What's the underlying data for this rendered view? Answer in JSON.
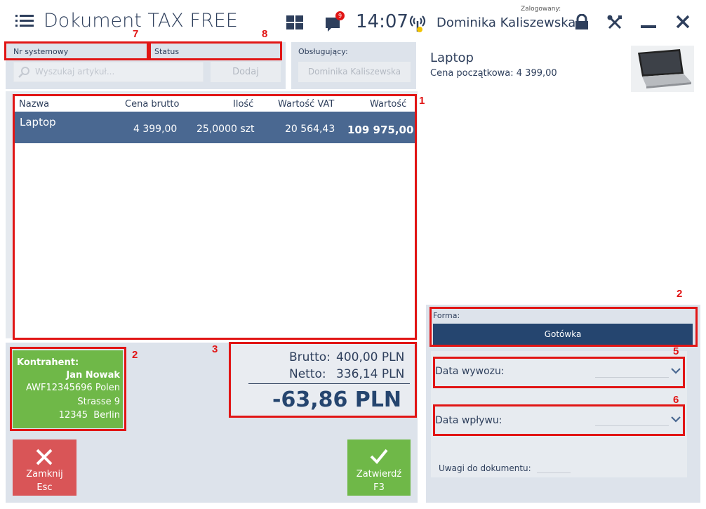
{
  "header": {
    "title": "Dokument TAX FREE",
    "notification_count": "9",
    "time": "14:07",
    "login_label": "Zalogowany:",
    "user_name": "Dominika Kaliszewska"
  },
  "filters": {
    "system_number_label": "Nr systemowy",
    "status_label": "Status",
    "search_placeholder": "Wyszukaj artykuł...",
    "add_button": "Dodaj",
    "operator_label": "Obsługujący:",
    "operator_value": "Dominika Kaliszewska"
  },
  "table": {
    "headers": [
      "Nazwa",
      "Cena brutto",
      "Ilość",
      "Wartość VAT",
      "Wartość"
    ],
    "rows": [
      {
        "name": "Laptop",
        "price": "4 399,00",
        "qty": "25,0000 szt",
        "vat": "20 564,43",
        "value": "109 975,00"
      }
    ]
  },
  "customer": {
    "label": "Kontrahent:",
    "name": "Jan Nowak",
    "line1": "AWF12345696 Polen",
    "line2": "Strasse 9",
    "line3": "12345  Berlin"
  },
  "totals": {
    "brutto_label": "Brutto:",
    "brutto_value": "400,00 PLN",
    "netto_label": "Netto:",
    "netto_value": "336,14 PLN",
    "total": "-63,86 PLN"
  },
  "actions": {
    "close_label": "Zamknij",
    "close_key": "Esc",
    "confirm_label": "Zatwierdź",
    "confirm_key": "F3"
  },
  "product": {
    "name": "Laptop",
    "price_line": "Cena początkowa: 4 399,00"
  },
  "payment": {
    "form_label": "Forma:",
    "form_value": "Gotówka",
    "export_date_label": "Data wywozu:",
    "inflow_date_label": "Data wpływu:",
    "notes_label": "Uwagi do dokumentu:"
  },
  "annotations": [
    "1",
    "2",
    "2",
    "3",
    "5",
    "6",
    "7",
    "8"
  ],
  "colors": {
    "accent": "#4a6891",
    "green": "#6fb848",
    "red_button": "#d95557",
    "annotation": "#e11515",
    "payment_button": "#25456f"
  }
}
